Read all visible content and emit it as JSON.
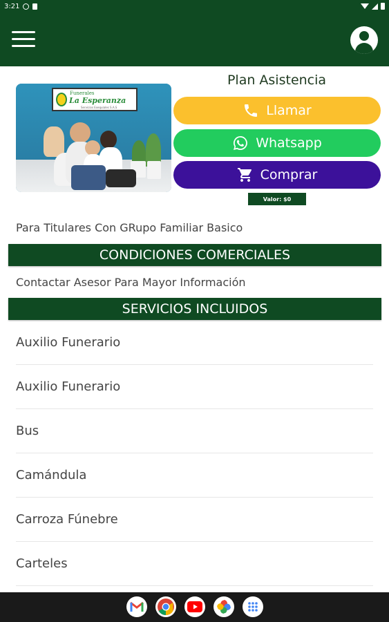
{
  "status_bar": {
    "time": "3:21"
  },
  "header": {
    "menu_icon": "hamburger-menu-icon",
    "account_icon": "account-circle-icon"
  },
  "product_image": {
    "logo_line1": "Funerales",
    "logo_line2": "La Esperanza",
    "logo_line3": "Servicios Exequiales S.A.S"
  },
  "plan": {
    "title": "Plan Asistencia",
    "buttons": [
      {
        "label": "Llamar",
        "icon": "phone-icon",
        "color": "#fbc02d"
      },
      {
        "label": "Whatsapp",
        "icon": "whatsapp-icon",
        "color": "#22cc5e"
      },
      {
        "label": "Comprar",
        "icon": "shopping-cart-icon",
        "color": "#3c119a"
      }
    ],
    "price": "Valor: $0",
    "description": "Para Titulares Con GRupo Familiar Basico"
  },
  "sections": {
    "conditions": {
      "title": "CONDICIONES COMERCIALES",
      "text": "Contactar Asesor Para Mayor Información"
    },
    "services": {
      "title": "SERVICIOS INCLUIDOS",
      "items": [
        "Auxilio Funerario",
        "Auxilio Funerario",
        "Bus",
        "Camándula",
        "Carroza Fúnebre",
        "Carteles"
      ]
    }
  },
  "dock": [
    "gmail-icon",
    "chrome-icon",
    "youtube-icon",
    "photos-icon",
    "app-drawer-icon"
  ],
  "colors": {
    "primary": "#0f4a22",
    "llamar": "#fbc02d",
    "whatsapp": "#22cc5e",
    "comprar": "#3c119a"
  }
}
